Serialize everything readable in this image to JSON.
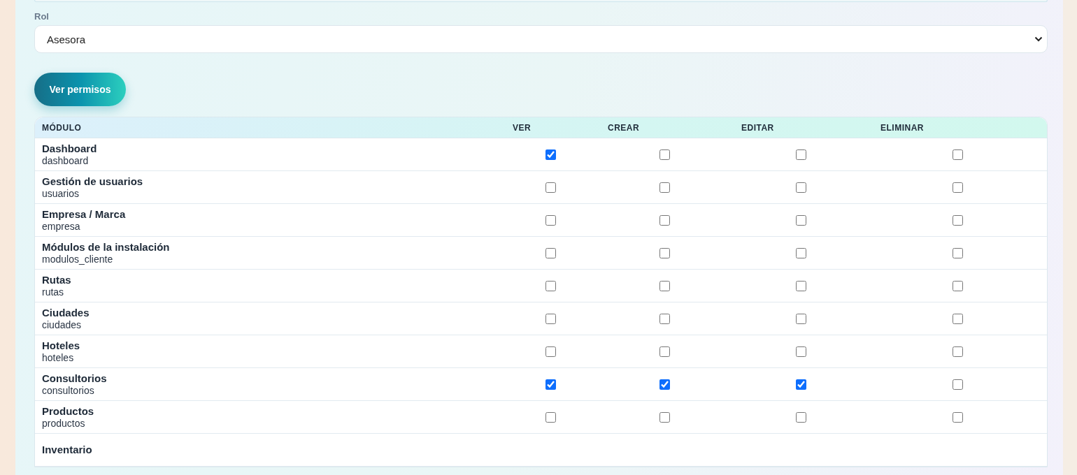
{
  "role_field": {
    "label": "Rol",
    "value": "Asesora"
  },
  "view_button": "Ver permisos",
  "table": {
    "columns": [
      "MÓDULO",
      "VER",
      "CREAR",
      "EDITAR",
      "ELIMINAR"
    ],
    "rows": [
      {
        "name": "Dashboard",
        "code": "dashboard",
        "perms": [
          {
            "checked": true
          },
          {
            "checked": false
          },
          {
            "checked": false
          },
          {
            "checked": false
          }
        ]
      },
      {
        "name": "Gestión de usuarios",
        "code": "usuarios",
        "perms": [
          {
            "checked": false
          },
          {
            "checked": false
          },
          {
            "checked": false
          },
          {
            "checked": false
          }
        ]
      },
      {
        "name": "Empresa / Marca",
        "code": "empresa",
        "perms": [
          {
            "checked": false
          },
          {
            "checked": false
          },
          {
            "checked": false
          },
          {
            "checked": false
          }
        ]
      },
      {
        "name": "Módulos de la instalación",
        "code": "modulos_cliente",
        "perms": [
          {
            "checked": false
          },
          {
            "checked": false
          },
          {
            "checked": false
          },
          {
            "checked": false
          }
        ]
      },
      {
        "name": "Rutas",
        "code": "rutas",
        "perms": [
          {
            "checked": false
          },
          {
            "checked": false
          },
          {
            "checked": false
          },
          {
            "checked": false
          }
        ]
      },
      {
        "name": "Ciudades",
        "code": "ciudades",
        "perms": [
          {
            "checked": false
          },
          {
            "checked": false
          },
          {
            "checked": false
          },
          {
            "checked": false
          }
        ]
      },
      {
        "name": "Hoteles",
        "code": "hoteles",
        "perms": [
          {
            "checked": false
          },
          {
            "checked": false
          },
          {
            "checked": false
          },
          {
            "checked": false
          }
        ]
      },
      {
        "name": "Consultorios",
        "code": "consultorios",
        "perms": [
          {
            "checked": true
          },
          {
            "checked": true
          },
          {
            "checked": true
          },
          {
            "checked": false
          }
        ]
      },
      {
        "name": "Productos",
        "code": "productos",
        "perms": [
          {
            "checked": false
          },
          {
            "checked": false
          },
          {
            "checked": false
          },
          {
            "checked": false
          }
        ]
      },
      {
        "name": "Inventario"
      }
    ]
  }
}
